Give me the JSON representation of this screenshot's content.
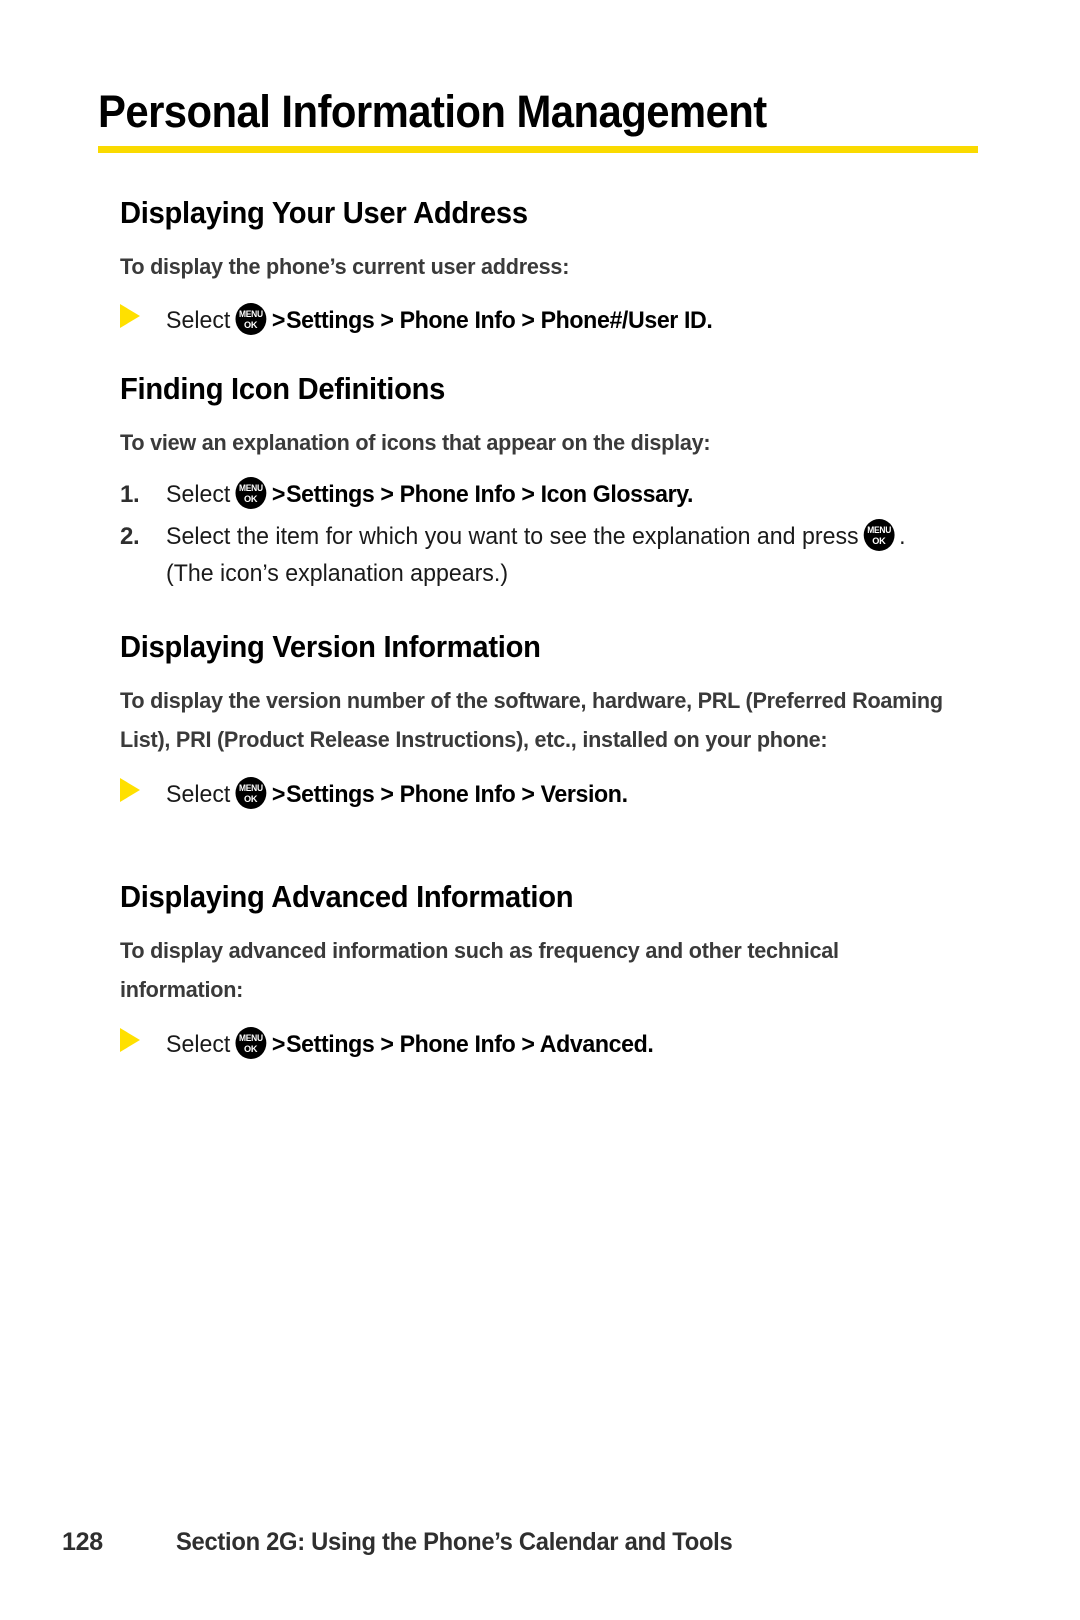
{
  "page": {
    "title": "Personal Information Management",
    "rule_color": "#FADA00",
    "bullet_color": "#FFE000"
  },
  "icons": {
    "menu_ok": {
      "top": "MENU",
      "bottom": "OK"
    },
    "chevron": ">"
  },
  "sections": [
    {
      "heading": "Displaying Your User Address",
      "lead": "To display the phone’s current user address:",
      "steps": [
        {
          "marker": "▶",
          "verb": "Select",
          "has_icon": true,
          "path": "Settings > Phone Info > Phone#/User ID",
          "tail": "."
        }
      ]
    },
    {
      "heading": "Finding Icon Definitions",
      "lead": "To view an explanation of icons that appear on the display:",
      "steps": [
        {
          "marker": "1.",
          "verb": "Select",
          "has_icon": true,
          "path": "Settings > Phone Info > Icon Glossary",
          "tail": "."
        },
        {
          "marker": "2.",
          "text_before": "Select the item for which you want to see the explanation and press",
          "has_icon": true,
          "text_after": ". (The icon’s explanation appears.)"
        }
      ]
    },
    {
      "heading": "Displaying Version Information",
      "lead": "To display the version number of the software, hardware, PRL (Preferred Roaming List), PRI (Product Release Instructions), etc., installed on your phone:",
      "steps": [
        {
          "marker": "▶",
          "verb": "Select",
          "has_icon": true,
          "path": "Settings > Phone Info > Version",
          "tail": "."
        }
      ]
    },
    {
      "heading": "Displaying Advanced Information",
      "lead": "To display advanced information such as frequency and other technical information:",
      "steps": [
        {
          "marker": "▶",
          "verb": "Select",
          "has_icon": true,
          "path": "Settings > Phone Info > Advanced",
          "tail": "."
        }
      ]
    }
  ],
  "footer": {
    "page_number": "128",
    "section_label": "Section 2G: Using the Phone’s Calendar and Tools"
  }
}
